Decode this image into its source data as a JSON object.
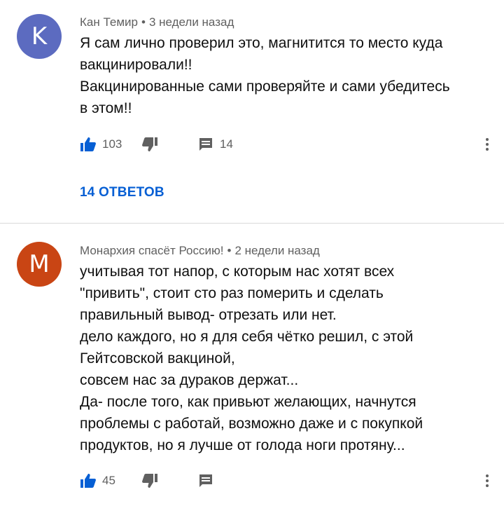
{
  "comments": [
    {
      "avatar_letter": "K",
      "avatar_color": "#5c6bc0",
      "author": "Кан Темир",
      "time": "3 недели назад",
      "lines": [
        "Я сам лично проверил это, магнитится то место куда",
        "вакцинировали!!",
        "Вакцинированные сами проверяйте и сами убедитесь",
        "в этом!!"
      ],
      "likes": "103",
      "replies_count": "14",
      "replies_label": "14 ОТВЕТОВ"
    },
    {
      "avatar_letter": "M",
      "avatar_color": "#c94514",
      "author": "Монархия спасёт Россию!",
      "time": "2 недели назад",
      "lines": [
        "учитывая тот напор, с которым нас хотят всех",
        "\"привить\", стоит сто раз померить и сделать",
        "правильный вывод- отрезать или нет.",
        "дело каждого, но я для себя чётко решил, с этой",
        "Гейтсовской вакциной,",
        "совсем нас за дураков держат...",
        "Да- после того, как привьют желающих, начнутся",
        "проблемы с работай, возможно даже и с покупкой",
        "продуктов, но я лучше от голода ноги протяну..."
      ],
      "likes": "45"
    }
  ],
  "icons": {
    "like": "thumbs-up-icon",
    "dislike": "thumbs-down-icon",
    "reply": "comment-icon",
    "menu": "more-vert-icon"
  },
  "colors": {
    "like_active": "#065fd4",
    "icon_gray": "#606060",
    "link": "#065fd4"
  }
}
